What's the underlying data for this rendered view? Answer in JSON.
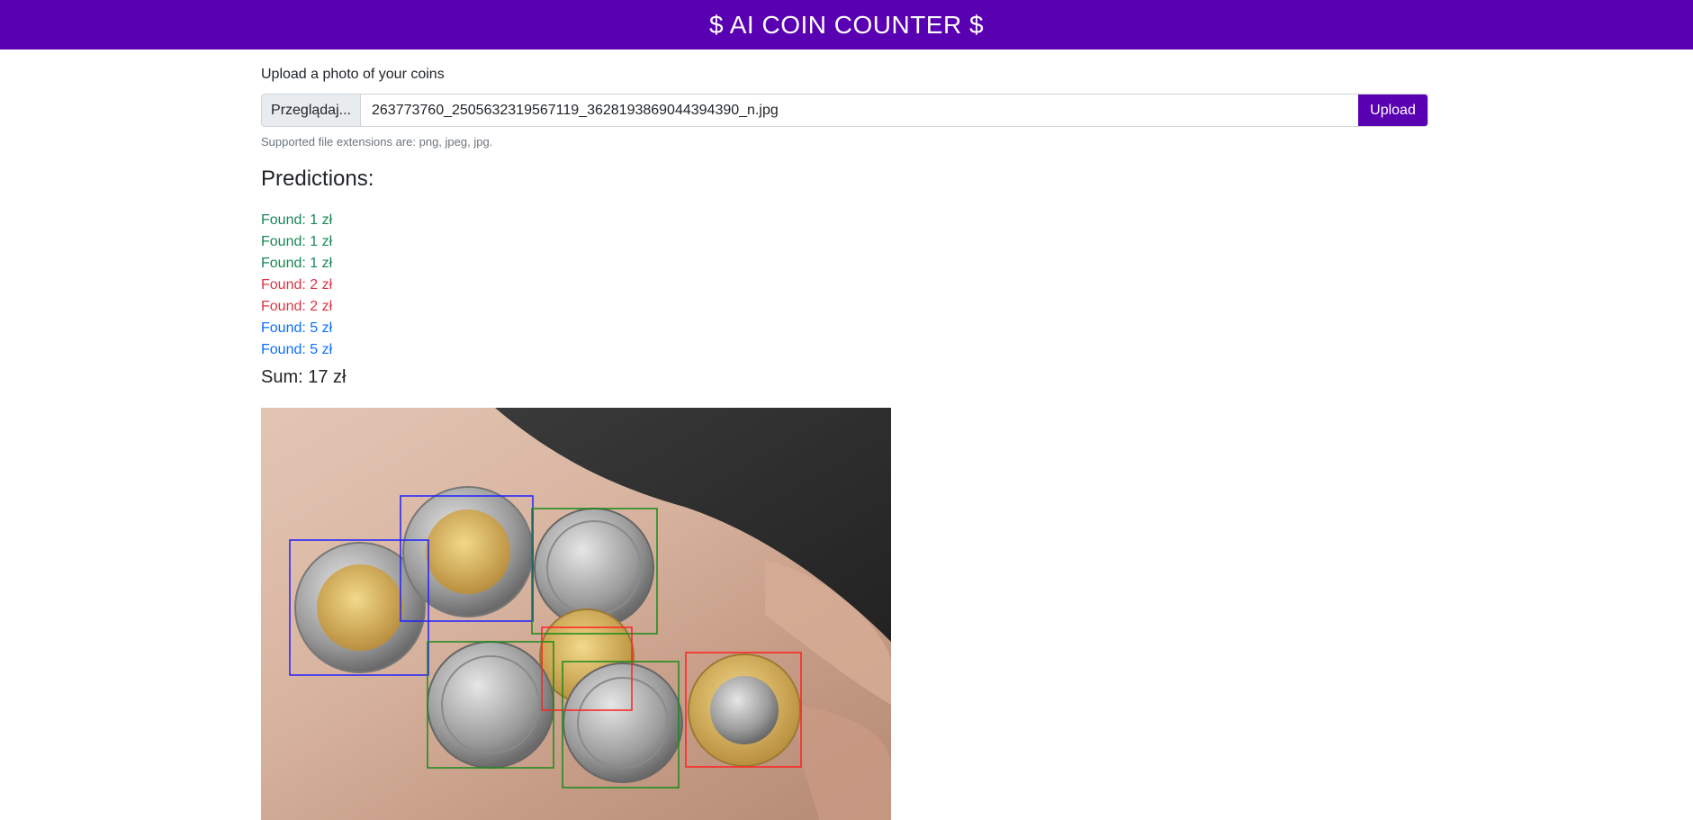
{
  "header": {
    "title": "$ AI COIN COUNTER $"
  },
  "upload": {
    "label": "Upload a photo of your coins",
    "browse_label": "Przeglądaj...",
    "filename": "263773760_2505632319567119_3628193869044394390_n.jpg",
    "upload_label": "Upload",
    "help_text": "Supported file extensions are: png, jpeg, jpg."
  },
  "predictions": {
    "title": "Predictions:",
    "items": [
      {
        "text": "Found: 1 zł",
        "color": "#198754"
      },
      {
        "text": "Found: 1 zł",
        "color": "#198754"
      },
      {
        "text": "Found: 1 zł",
        "color": "#198754"
      },
      {
        "text": "Found: 2 zł",
        "color": "#dc3545"
      },
      {
        "text": "Found: 2 zł",
        "color": "#dc3545"
      },
      {
        "text": "Found: 5 zł",
        "color": "#0d6efd"
      },
      {
        "text": "Found: 5 zł",
        "color": "#0d6efd"
      }
    ],
    "sum": "Sum: 17 zł"
  },
  "colors": {
    "brand": "#5a00b3",
    "one_zl": "#198754",
    "two_zl": "#dc3545",
    "five_zl": "#0d6efd"
  }
}
